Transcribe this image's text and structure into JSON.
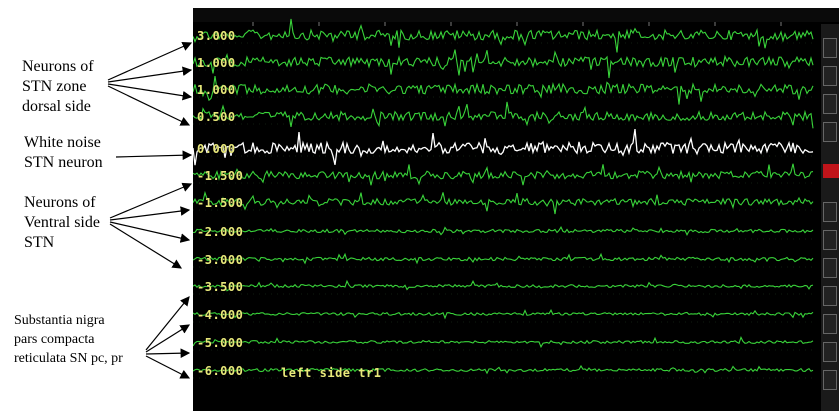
{
  "annotations": {
    "dorsal": "Neurons of\nSTN zone\ndorsal side",
    "white_noise": "White noise\nSTN neuron",
    "ventral": "Neurons of\nVentral side\nSTN",
    "substantia": "Substantia nigra\npars compacta\nreticulata SN pc, pr"
  },
  "scale_labels": [
    "3.000",
    "1.000",
    "1.000",
    "0.500",
    "0.000",
    "-1.500",
    "-1.500",
    "-2.000",
    "-3.000",
    "-3.500",
    "-4.000",
    "-5.000",
    "-6.000"
  ],
  "trial_label": "left side tr1",
  "colors": {
    "trace": "#39d33a",
    "highlight_trace": "#ffffff",
    "label": "#e8e87a",
    "marker": "#c0141a",
    "background": "#000000"
  }
}
